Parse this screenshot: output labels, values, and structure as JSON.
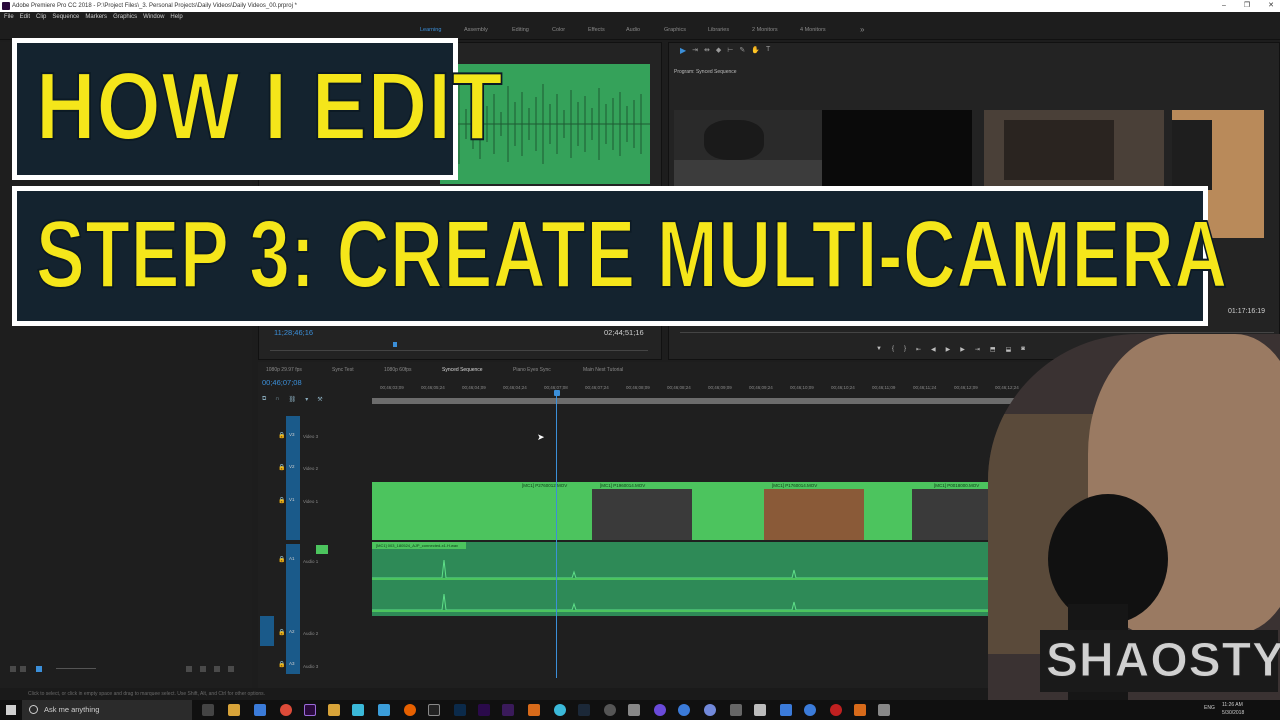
{
  "window": {
    "title": "Adobe Premiere Pro CC 2018 - P:\\Project Files\\_3. Personal Projects\\Daily Videos\\Daily Videos_00.prproj *",
    "controls": [
      "–",
      "❐",
      "✕"
    ]
  },
  "menu": [
    "File",
    "Edit",
    "Clip",
    "Sequence",
    "Markers",
    "Graphics",
    "Window",
    "Help"
  ],
  "workspaces": {
    "items": [
      "Learning",
      "Assembly",
      "Editing",
      "Color",
      "Effects",
      "Audio",
      "Graphics",
      "Libraries",
      "2 Monitors",
      "4 Monitors"
    ],
    "active": "Learning",
    "more": "»"
  },
  "program_monitor": {
    "title": "Program: Synced Sequence",
    "timecode": "01:17:16:19"
  },
  "source_monitor": {
    "timecode_left": "11;28;46;16",
    "timecode_right": "02;44;51;16"
  },
  "timeline": {
    "tabs": [
      "1080p 29.97 fps",
      "Sync Test",
      "1080p 60fps",
      "Synced Sequence",
      "Piano Eyes Sync",
      "Main Nest Tutorial"
    ],
    "active_tab": "Synced Sequence",
    "timecode": "00;46;07;08",
    "ruler": [
      "00;46;03;09",
      "00;46;05;24",
      "00;46;04;09",
      "00;46;04;24",
      "00;46;07;08",
      "00;46;07;24",
      "00;46;08;09",
      "00;46;08;24",
      "00;46;09;09",
      "00;46;09;24",
      "00;46;10;09",
      "00;46;10;24",
      "00;46;11;09",
      "00;46;11;24",
      "00;46;12;09",
      "00;46;12;24"
    ],
    "tracks": {
      "video": [
        {
          "id": "V3",
          "name": "Video 3"
        },
        {
          "id": "V2",
          "name": "Video 2"
        },
        {
          "id": "V1",
          "name": "Video 1"
        }
      ],
      "audio": [
        {
          "id": "A1",
          "name": "Audio 1"
        },
        {
          "id": "A2",
          "name": "Audio 2"
        },
        {
          "id": "A3",
          "name": "Audio 3"
        }
      ]
    },
    "clip_labels": [
      "[MC1] P2760012.MOV",
      "[MC1] P1960014.MOV",
      "[MC1] P1760014.MOV",
      "[MC1] P0018000.MOV"
    ],
    "audio_clip_label": "[MC1] 003_180524_AJP_connected-x1.H.wav"
  },
  "status_bar": "Click to select, or click in empty space and drag to marquee select. Use Shift, Alt, and Ctrl for other options.",
  "overlay": {
    "line1": "HOW I EDIT",
    "line2": "STEP 3: CREATE MULTI-CAMERA",
    "brand": "SHAOSTYLE"
  },
  "taskbar": {
    "search_placeholder": "Ask me anything",
    "time": "11:26 AM",
    "date": "5/30/2018",
    "lang": "ENG"
  },
  "colors": {
    "accent_blue": "#3b8fd9",
    "overlay_yellow": "#f5e61a",
    "overlay_box": "#14232f",
    "clip_green": "#4cc45e",
    "audio_green": "#2e8a57"
  }
}
